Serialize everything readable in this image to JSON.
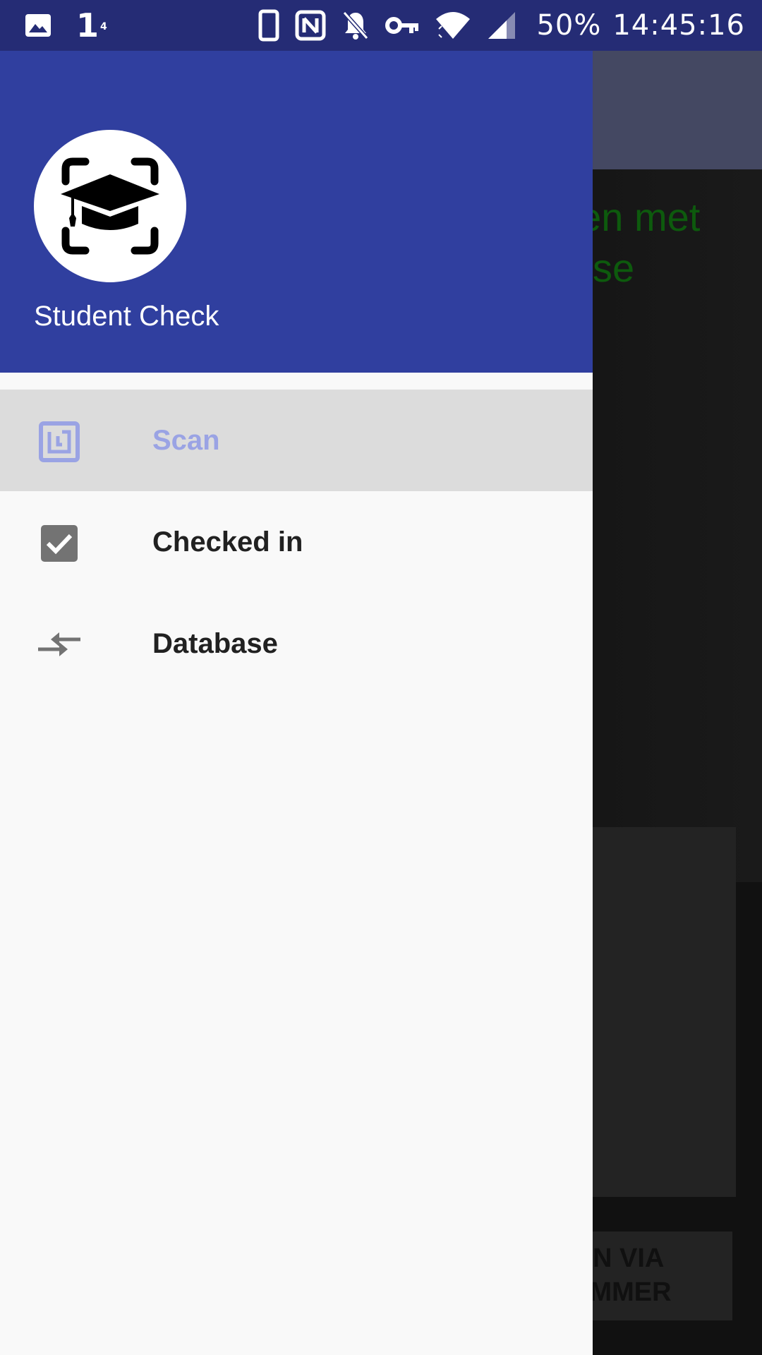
{
  "status_bar": {
    "left_icons": [
      "gallery-icon"
    ],
    "notification_number": "1",
    "notification_superscript": "4",
    "right_icons": [
      "phone-icon",
      "nfc-icon",
      "notifications-off-icon",
      "vpn-key-icon",
      "wifi-icon",
      "cell-signal-icon"
    ],
    "battery": "50%",
    "time": "14:45:16"
  },
  "background_app": {
    "text_lines": [
      "den met",
      "se"
    ],
    "button_lines": [
      "N VIA",
      "UMMER"
    ],
    "text_color": "#0d5a0d"
  },
  "drawer": {
    "header_color": "#303f9f",
    "logo_icon": "graduation-cap-scan-icon",
    "app_title": "Student Check",
    "menu": [
      {
        "label": "Scan",
        "icon": "nfc-icon",
        "selected": true
      },
      {
        "label": "Checked in",
        "icon": "checkbox-checked-icon",
        "selected": false
      },
      {
        "label": "Database",
        "icon": "compare-arrows-icon",
        "selected": false
      }
    ]
  },
  "colors": {
    "status_bar": "#252c75",
    "accent_selected_text": "#9aa3e4",
    "selected_row": "#dcdcdc"
  }
}
